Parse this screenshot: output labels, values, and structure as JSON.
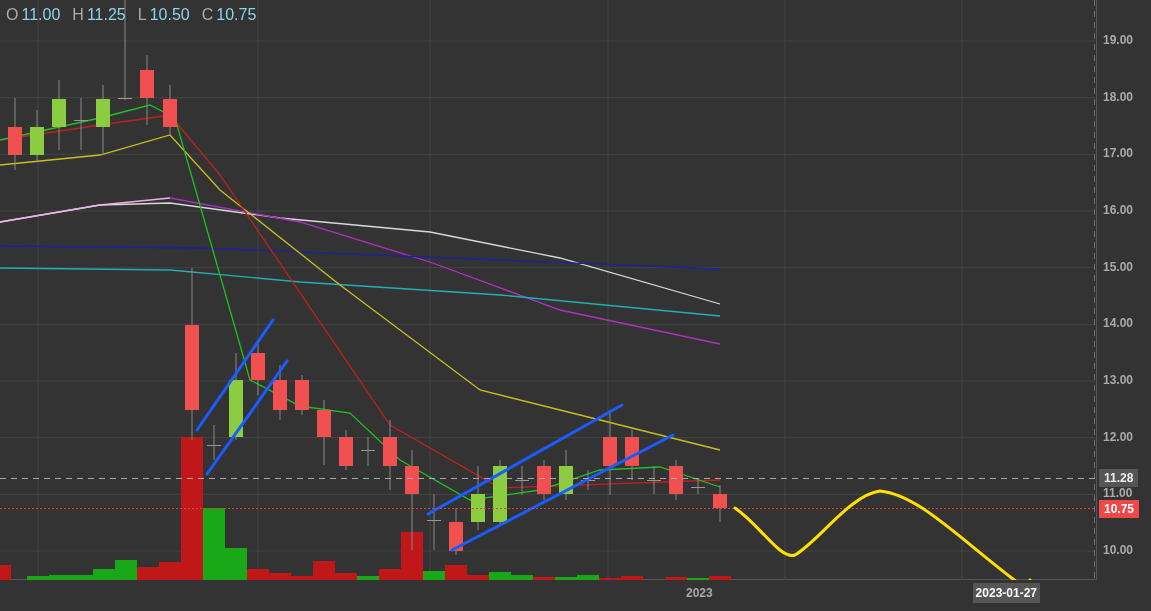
{
  "ohlc": [
    {
      "label": "O",
      "value": "11.00"
    },
    {
      "label": "H",
      "value": "11.25"
    },
    {
      "label": "L",
      "value": "10.50"
    },
    {
      "label": "C",
      "value": "10.75"
    }
  ],
  "price_axis": {
    "ticks": [
      "19.00",
      "18.00",
      "17.00",
      "16.00",
      "15.00",
      "14.00",
      "13.00",
      "12.00",
      "11.00",
      "10.00"
    ],
    "markers": [
      {
        "kind": "previous",
        "label": "11.28"
      },
      {
        "kind": "current",
        "label": "10.75"
      }
    ]
  },
  "time_axis": {
    "labels": [
      "2023"
    ],
    "cursor_date": "2023-01-27"
  }
}
